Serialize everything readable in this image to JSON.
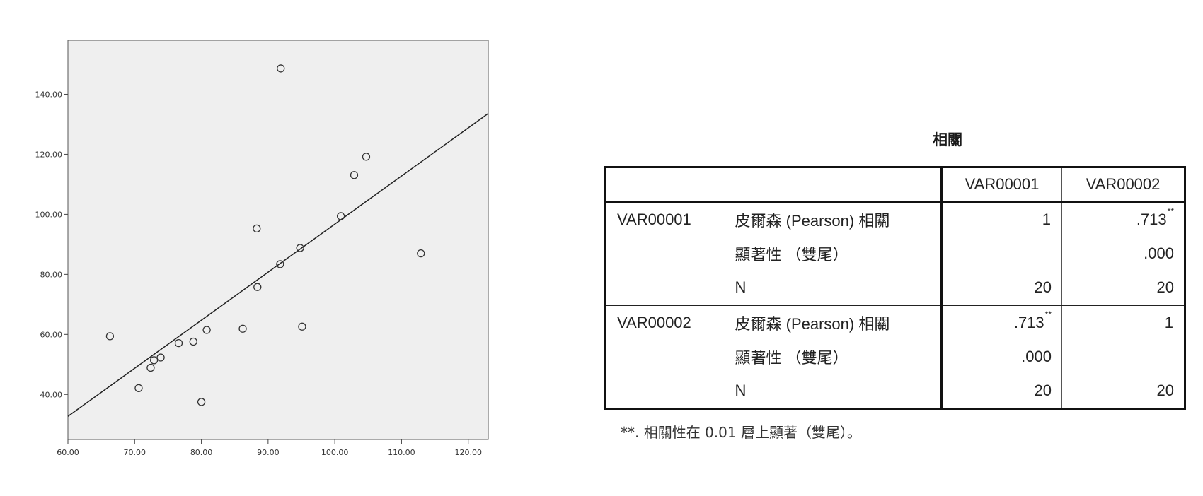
{
  "chart_data": {
    "type": "scatter",
    "title": "",
    "xlabel": "",
    "ylabel": "",
    "xlim": [
      60,
      123
    ],
    "ylim": [
      25,
      158
    ],
    "grid": false,
    "background": "#efefef",
    "point_color": "#333333",
    "line_color": "#222222",
    "x_ticks": [
      60,
      70,
      80,
      90,
      100,
      110,
      120
    ],
    "x_tick_labels": [
      "60.00",
      "70.00",
      "80.00",
      "90.00",
      "100.00",
      "110.00",
      "120.00"
    ],
    "y_ticks": [
      40,
      60,
      80,
      100,
      120,
      140
    ],
    "y_tick_labels": [
      "40.00",
      "60.00",
      "80.00",
      "100.00",
      "120.00",
      "140.00"
    ],
    "points": [
      {
        "x": 66.3,
        "y": 59.4
      },
      {
        "x": 70.6,
        "y": 42.1
      },
      {
        "x": 72.4,
        "y": 48.9
      },
      {
        "x": 72.9,
        "y": 51.4
      },
      {
        "x": 73.9,
        "y": 52.3
      },
      {
        "x": 76.6,
        "y": 57.1
      },
      {
        "x": 78.8,
        "y": 57.6
      },
      {
        "x": 80.0,
        "y": 37.5
      },
      {
        "x": 80.8,
        "y": 61.5
      },
      {
        "x": 86.2,
        "y": 61.9
      },
      {
        "x": 88.3,
        "y": 95.3
      },
      {
        "x": 88.4,
        "y": 75.8
      },
      {
        "x": 91.8,
        "y": 83.4
      },
      {
        "x": 91.9,
        "y": 148.6
      },
      {
        "x": 94.8,
        "y": 88.8
      },
      {
        "x": 95.1,
        "y": 62.6
      },
      {
        "x": 100.9,
        "y": 99.4
      },
      {
        "x": 102.9,
        "y": 113.1
      },
      {
        "x": 104.7,
        "y": 119.2
      },
      {
        "x": 112.9,
        "y": 87.0
      }
    ],
    "fit_line": {
      "x": [
        60,
        123
      ],
      "y": [
        32.7,
        133.6
      ]
    }
  },
  "table": {
    "title": "相關",
    "header": [
      "",
      "VAR00001",
      "VAR00002"
    ],
    "blocks": [
      {
        "variable": "VAR00001",
        "rows": [
          {
            "label": "皮爾森 (Pearson) 相關",
            "v1": "1",
            "v2": ".713",
            "v1_mark": "",
            "v2_mark": "**"
          },
          {
            "label": "顯著性 （雙尾）",
            "v1": "",
            "v2": ".000",
            "v1_mark": "",
            "v2_mark": ""
          },
          {
            "label": "N",
            "v1": "20",
            "v2": "20",
            "v1_mark": "",
            "v2_mark": ""
          }
        ]
      },
      {
        "variable": "VAR00002",
        "rows": [
          {
            "label": "皮爾森 (Pearson) 相關",
            "v1": ".713",
            "v2": "1",
            "v1_mark": "**",
            "v2_mark": ""
          },
          {
            "label": "顯著性 （雙尾）",
            "v1": ".000",
            "v2": "",
            "v1_mark": "",
            "v2_mark": ""
          },
          {
            "label": "N",
            "v1": "20",
            "v2": "20",
            "v1_mark": "",
            "v2_mark": ""
          }
        ]
      }
    ],
    "footnote": "**. 相關性在 0.01 層上顯著（雙尾）。"
  }
}
